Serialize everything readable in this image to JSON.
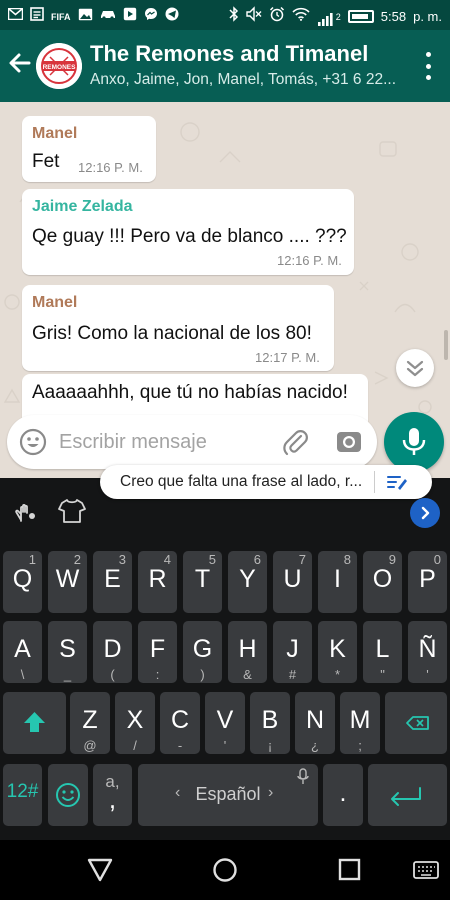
{
  "status_bar": {
    "left_icons": [
      "gmail-icon",
      "news-icon",
      "fifa-icon",
      "image-icon",
      "car-icon",
      "video-icon",
      "messenger-icon",
      "telegram-icon"
    ],
    "fifa_text": "FIFA",
    "network_type": "2",
    "time": "5:58",
    "time_suffix": "p. m."
  },
  "header": {
    "title": "The Remones and Timanel",
    "subtitle": "Anxo, Jaime, Jon, Manel, Tomás, +31 6 22...",
    "avatar_text": "REMONES"
  },
  "messages": [
    {
      "sender": "Manel",
      "sender_color": "#b07a59",
      "text": "Fet",
      "time": "12:16 P. M."
    },
    {
      "sender": "Jaime Zelada",
      "sender_color": "#35b5a0",
      "text": "Qe guay !!! Pero va de blanco .... ???",
      "time": "12:16 P. M."
    },
    {
      "sender": "Manel",
      "sender_color": "#b07a59",
      "text": "Gris! Como la nacional de los 80!",
      "time": "12:17 P. M."
    },
    {
      "text": "Aaaaaahhh, que tú no habías nacido!"
    }
  ],
  "composer": {
    "placeholder": "Escribir mensaje"
  },
  "keyboard": {
    "suggestion": "Creo que falta una frase al lado, r...",
    "row1": [
      {
        "main": "Q",
        "hint": "1"
      },
      {
        "main": "W",
        "hint": "2"
      },
      {
        "main": "E",
        "hint": "3"
      },
      {
        "main": "R",
        "hint": "4"
      },
      {
        "main": "T",
        "hint": "5"
      },
      {
        "main": "Y",
        "hint": "6"
      },
      {
        "main": "U",
        "hint": "7"
      },
      {
        "main": "I",
        "hint": "8"
      },
      {
        "main": "O",
        "hint": "9"
      },
      {
        "main": "P",
        "hint": "0"
      }
    ],
    "row2": [
      {
        "main": "A",
        "sub": "\\"
      },
      {
        "main": "S",
        "sub": "_"
      },
      {
        "main": "D",
        "sub": "("
      },
      {
        "main": "F",
        "sub": ":"
      },
      {
        "main": "G",
        "sub": ")"
      },
      {
        "main": "H",
        "sub": "&"
      },
      {
        "main": "J",
        "sub": "#"
      },
      {
        "main": "K",
        "sub": "*"
      },
      {
        "main": "L",
        "sub": "\""
      },
      {
        "main": "Ñ",
        "sub": "'"
      }
    ],
    "row3": [
      {
        "main": "Z",
        "sub": "@"
      },
      {
        "main": "X",
        "sub": "/"
      },
      {
        "main": "C",
        "sub": "-"
      },
      {
        "main": "V",
        "sub": "'"
      },
      {
        "main": "B",
        "sub": "¡"
      },
      {
        "main": "N",
        "sub": "¿"
      },
      {
        "main": "M",
        "sub": ";"
      }
    ],
    "numbers_label": "12#",
    "comma_hint": "a,",
    "comma_label": ",",
    "space_label": "Español",
    "space_arrow_left": "‹",
    "space_arrow_right": "›",
    "period_label": "."
  },
  "colors": {
    "header": "#075e54",
    "status_bar": "#05483f",
    "accent": "#00897b",
    "accent_key": "#26c6b0"
  }
}
